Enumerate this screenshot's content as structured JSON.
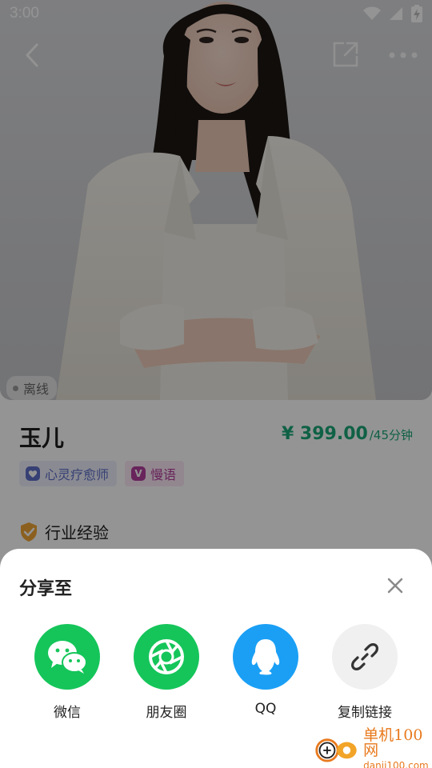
{
  "status_bar": {
    "time": "3:00",
    "icons": [
      "wifi-icon",
      "signal-icon",
      "battery-charging-icon"
    ]
  },
  "nav": {
    "back_icon": "chevron-left-icon",
    "share_icon": "share-out-icon",
    "more_icon": "more-dots-icon"
  },
  "profile": {
    "status": "离线",
    "name": "玉儿",
    "price": "¥ 399.00",
    "price_unit": "/45分钟",
    "tags": [
      {
        "label": "心灵疗愈师",
        "icon": "heart-shield-icon",
        "color": "#5f6ec8"
      },
      {
        "label": "慢语",
        "icon": "v-badge-icon",
        "color": "#b43f9d"
      }
    ],
    "section_title": "行业经验"
  },
  "share_sheet": {
    "title": "分享至",
    "options": [
      {
        "label": "微信",
        "icon": "wechat-icon",
        "color": "#15c55a"
      },
      {
        "label": "朋友圈",
        "icon": "moments-icon",
        "color": "#15c55a"
      },
      {
        "label": "QQ",
        "icon": "qq-icon",
        "color": "#1a9ff5"
      },
      {
        "label": "复制链接",
        "icon": "link-icon",
        "color": "#f0f0f0"
      }
    ]
  },
  "watermark": {
    "main": "单机100网",
    "sub": "danji100.com"
  },
  "colors": {
    "accent_green": "#1aa779",
    "wechat_green": "#15c55a",
    "qq_blue": "#1a9ff5",
    "watermark_orange": "#e87a1e"
  }
}
